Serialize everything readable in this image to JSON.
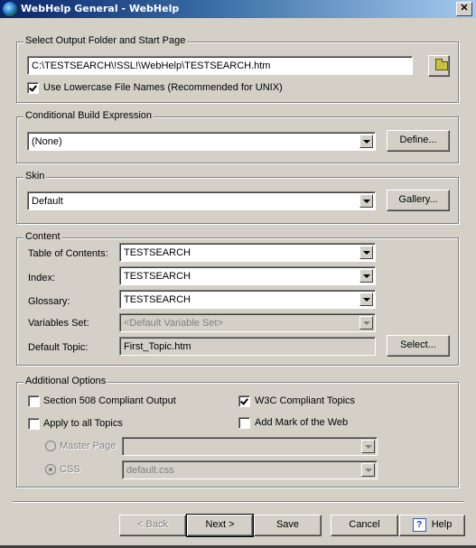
{
  "window": {
    "title": "WebHelp General - WebHelp",
    "close_label": "✕"
  },
  "output": {
    "legend": "Select Output Folder and Start Page",
    "path_value": "C:\\TESTSEARCH\\!SSL!\\WebHelp\\TESTSEARCH.htm",
    "lowercase_label": "Use Lowercase File Names (Recommended for UNIX)",
    "lowercase_checked": true
  },
  "conditional": {
    "legend": "Conditional Build Expression",
    "value": "(None)",
    "define_label": "Define..."
  },
  "skin": {
    "legend": "Skin",
    "value": "Default",
    "gallery_label": "Gallery..."
  },
  "content": {
    "legend": "Content",
    "toc_label": "Table of Contents:",
    "toc_value": "TESTSEARCH",
    "index_label": "Index:",
    "index_value": "TESTSEARCH",
    "glossary_label": "Glossary:",
    "glossary_value": "TESTSEARCH",
    "variables_label": "Variables Set:",
    "variables_value": "<Default Variable Set>",
    "default_topic_label": "Default Topic:",
    "default_topic_value": "First_Topic.htm",
    "select_label": "Select..."
  },
  "additional": {
    "legend": "Additional Options",
    "section508_label": "Section 508 Compliant Output",
    "section508_checked": false,
    "w3c_label": "W3C Compliant Topics",
    "w3c_checked": true,
    "apply_all_label": "Apply to all Topics",
    "apply_all_checked": false,
    "mark_web_label": "Add Mark of the Web",
    "mark_web_checked": false,
    "master_page_label": "Master Page",
    "master_page_value": "",
    "css_label": "CSS",
    "css_value": "default.css"
  },
  "footer": {
    "back_label": "< Back",
    "next_label": "Next >",
    "save_label": "Save",
    "cancel_label": "Cancel",
    "help_label": "Help",
    "help_icon_glyph": "?"
  }
}
